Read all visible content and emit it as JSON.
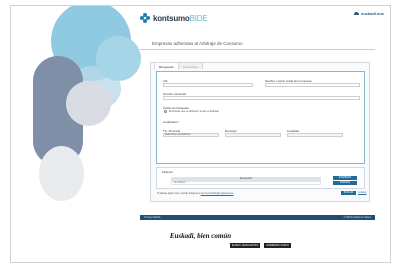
{
  "header": {
    "logo_main": "kontsumo",
    "logo_suffix": "BIDE",
    "brand": "euskadi.eus"
  },
  "page": {
    "title": "Empresas adheridas al Arbitraje de Consumo"
  },
  "tabs": [
    {
      "label": "Búsqueda"
    },
    {
      "label": "Resultados"
    }
  ],
  "form": {
    "cif_label": "CIF",
    "name_label": "Nombre o razón social de la empresa",
    "trade_label": "Nombre comercial",
    "scope_label": "Ámbito de búsqueda",
    "scope_option": "Empresas que se adhieren a todo el arbitraje",
    "location_label": "Localización",
    "province_label": "Tín. Provincia",
    "province_value": "Seleccione un elemento",
    "municipality_label": "Municipio",
    "locality_label": "Localidad"
  },
  "upload": {
    "label": "Ficheros",
    "column_header": "Descripción",
    "file_value": "Sin fichero",
    "examine_label": "EXAMINAR",
    "delete_label": "BORRAR"
  },
  "actions": {
    "note_prefix": "Si desea algún otro, puede dirigirse a",
    "note_link": "kontsumobide@euskadi.eus",
    "send_label": "BUSCAR",
    "clear_label": "Limpiar"
  },
  "footer": {
    "left": "Kontsumobide",
    "right": "© 2019 Gobierno Vasco"
  },
  "slogan": "Euskadi, bien común",
  "gov_logos": [
    "EUSKO JAURLARITZA",
    "GOBIERNO VASCO"
  ]
}
